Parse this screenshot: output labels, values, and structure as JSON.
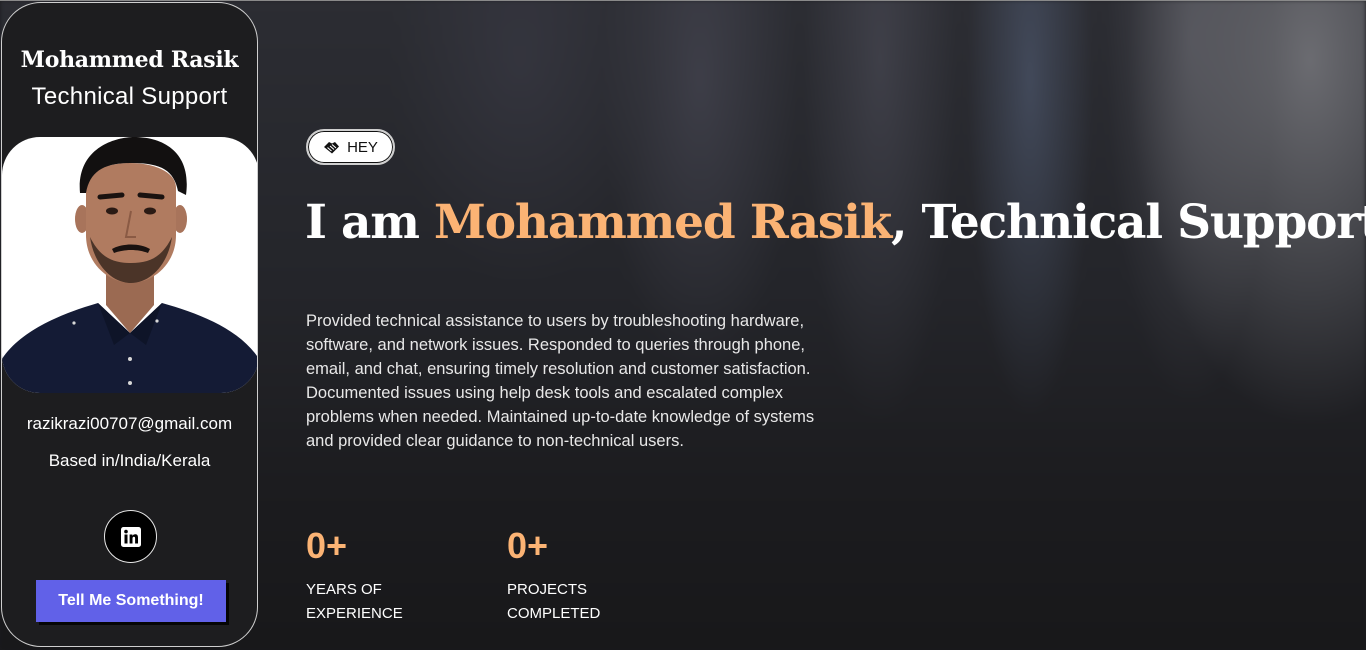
{
  "profile": {
    "name": "Mohammed Rasik",
    "role": "Technical Support",
    "email": "razikrazi00707@gmail.com",
    "location": "Based in/India/Kerala",
    "social_icon": "linkedin-icon",
    "cta_label": "Tell Me Something!"
  },
  "hero": {
    "badge_label": "HEY",
    "badge_icon": "handshake-icon",
    "headline_prefix": "I am ",
    "headline_name": "Mohammed Rasik",
    "headline_suffix": ", Technical Support",
    "description": "Provided technical assistance to users by troubleshooting hardware, software, and network issues. Responded to queries through phone, email, and chat, ensuring timely resolution and customer satisfaction. Documented issues using help desk tools and escalated complex problems when needed. Maintained up-to-date knowledge of systems and provided clear guidance to non-technical users."
  },
  "stats": [
    {
      "value": "0+",
      "label_line1": "YEARS OF",
      "label_line2": "EXPERIENCE"
    },
    {
      "value": "0+",
      "label_line1": "PROJECTS",
      "label_line2": "COMPLETED"
    }
  ],
  "colors": {
    "accent": "#fbb374",
    "cta": "#6161e8",
    "background": "#1b1b1e"
  }
}
